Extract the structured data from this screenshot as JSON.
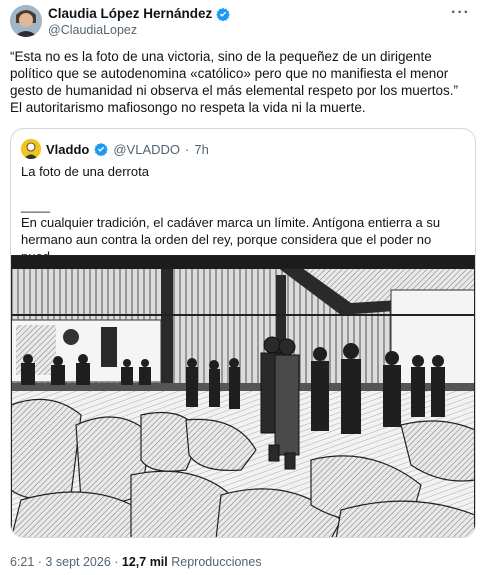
{
  "author": {
    "name": "Claudia López Hernández",
    "handle": "@ClaudiaLopez"
  },
  "tweet": {
    "text": "“Esta no es la foto de una victoria, sino de la pequeñez de un dirigente político que se autodenomina «católico» pero que no manifiesta el menor gesto de humanidad ni observa el más elemental respeto por los muertos.”\nEl autoritarismo mafiosongo no respeta la vida ni la muerte."
  },
  "quoted": {
    "name": "Vladdo",
    "handle": "@VLADDO",
    "separator": "·",
    "time": "7h",
    "text": "La foto de una derrota\n\n____\nEn cualquier tradición, el cadáver marca un límite. Antígona entierra a su hermano aun contra la orden del rey, porque considera que el poder no pued…"
  },
  "footer": {
    "time": "6:21 · 3 sept 2026 ·",
    "views": "12,7 mil",
    "views_label": "Reproducciones"
  },
  "icons": {
    "verified": "verified-badge-icon",
    "more": "more-options-icon"
  },
  "colors": {
    "verified_blue": "#1d9bf0",
    "secondary_text": "#536471",
    "border": "#cfd9de"
  }
}
